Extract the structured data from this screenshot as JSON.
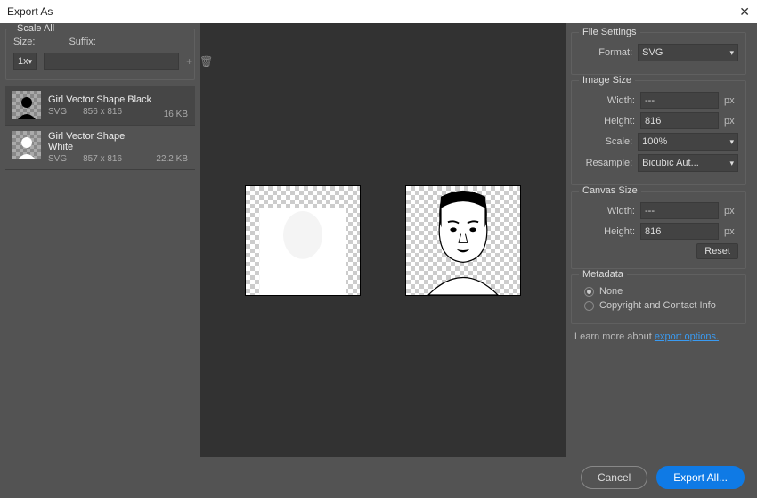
{
  "window": {
    "title": "Export As"
  },
  "scaleAll": {
    "legend": "Scale All",
    "sizeLabel": "Size:",
    "suffixLabel": "Suffix:",
    "sizeValue": "1x",
    "suffixValue": ""
  },
  "assets": [
    {
      "name": "Girl Vector Shape Black",
      "format": "SVG",
      "dims": "856 x 816",
      "filesize": "16 KB",
      "selected": true
    },
    {
      "name": "Girl Vector Shape White",
      "format": "SVG",
      "dims": "857 x 816",
      "filesize": "22.2 KB",
      "selected": false
    }
  ],
  "fileSettings": {
    "legend": "File Settings",
    "formatLabel": "Format:",
    "formatValue": "SVG"
  },
  "imageSize": {
    "legend": "Image Size",
    "widthLabel": "Width:",
    "widthValue": "---",
    "heightLabel": "Height:",
    "heightValue": "816",
    "scaleLabel": "Scale:",
    "scaleValue": "100%",
    "resampleLabel": "Resample:",
    "resampleValue": "Bicubic Aut...",
    "unit": "px"
  },
  "canvasSize": {
    "legend": "Canvas Size",
    "widthLabel": "Width:",
    "widthValue": "---",
    "heightLabel": "Height:",
    "heightValue": "816",
    "unit": "px",
    "resetLabel": "Reset"
  },
  "metadata": {
    "legend": "Metadata",
    "noneLabel": "None",
    "copyrightLabel": "Copyright and Contact Info",
    "selected": "none"
  },
  "learnMore": {
    "prefix": "Learn more about ",
    "linkText": "export options."
  },
  "footer": {
    "cancel": "Cancel",
    "exportAll": "Export All..."
  }
}
